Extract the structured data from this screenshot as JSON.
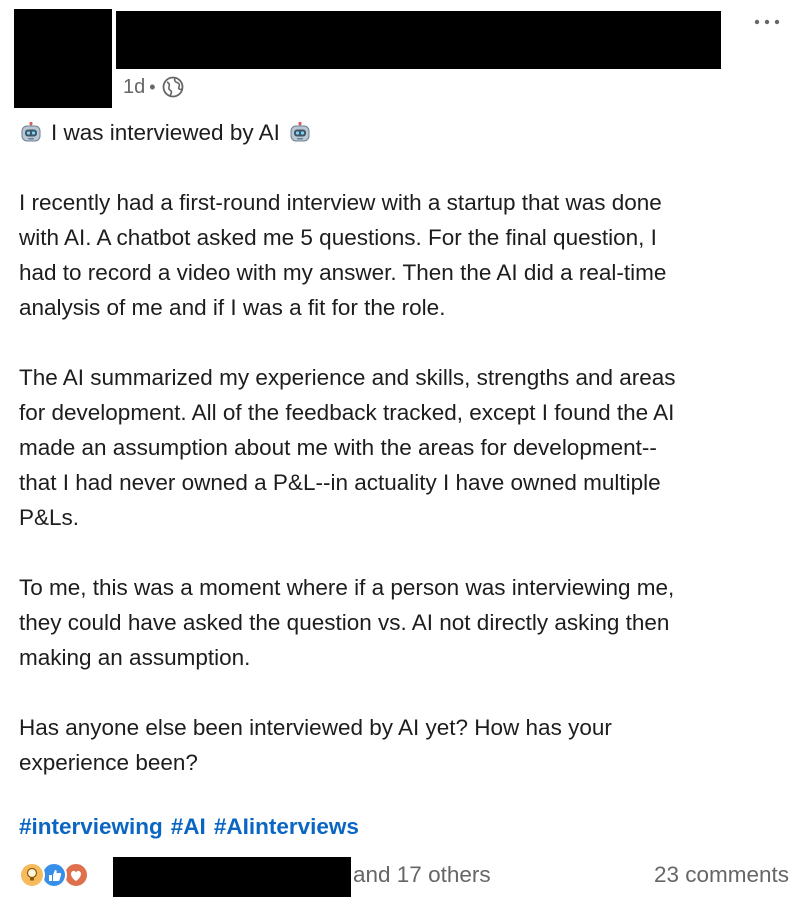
{
  "post": {
    "timestamp": "1d",
    "separator": "•",
    "visibility_icon": "globe-icon",
    "headline": "I was interviewed by AI",
    "headline_emoji": "robot-face-icon",
    "paragraphs": [
      "I recently had a first-round interview with a startup that was done\nwith AI. A chatbot asked me 5 questions. For the final question, I\nhad to record a video with my answer. Then the AI did a real-time\nanalysis of me and if I was a fit for the role.",
      "The AI summarized my experience and skills, strengths and areas\nfor development. All of the feedback tracked, except I found the AI\nmade an assumption about me with the areas for development--\nthat I had never owned a P&L--in actuality I have owned multiple\nP&Ls.",
      "To me, this was a moment where if a person was interviewing me,\nthey could have asked the question vs. AI not directly asking then\nmaking an assumption.",
      "Has anyone else been interviewed by AI yet? How has your\nexperience been?"
    ],
    "hashtags": [
      "#interviewing",
      "#AI",
      "#AIinterviews"
    ]
  },
  "social": {
    "reaction_icons": [
      "insightful-icon",
      "like-icon",
      "love-icon"
    ],
    "others_text": "and 17 others",
    "comments_text": "23 comments"
  },
  "colors": {
    "hashtag": "#0a66c2",
    "muted": "#666666",
    "text": "#1d1d1d"
  }
}
